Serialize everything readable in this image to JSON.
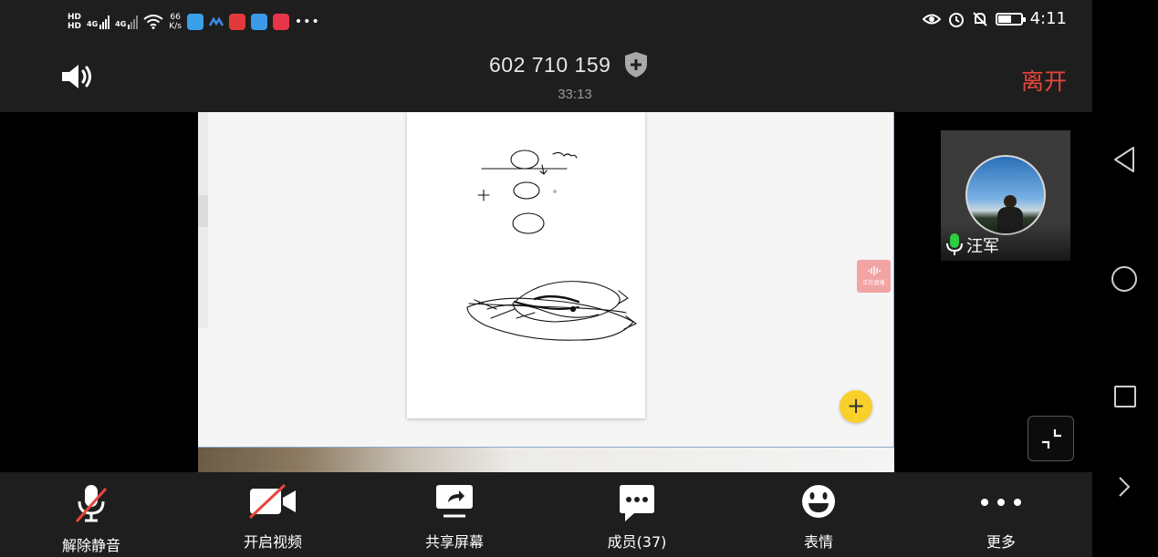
{
  "status_bar": {
    "network_top": "HD",
    "network_bottom": "HD",
    "sim1": "4G",
    "sim2": "4G",
    "speed_value": "66",
    "speed_unit": "K/s",
    "time": "4:11",
    "battery_level": 0.55
  },
  "header": {
    "meeting_id": "602 710 159",
    "elapsed": "33:13",
    "leave_label": "离开"
  },
  "shared_screen": {
    "live_badge_text": "正在直播",
    "fab_label": "+"
  },
  "participant": {
    "name": "汪军",
    "mic_color": "#2ecc40"
  },
  "toolbar": {
    "unmute_label": "解除静音",
    "video_label": "开启视频",
    "share_label": "共享屏幕",
    "members_label": "成员(37)",
    "reactions_label": "表情",
    "more_label": "更多"
  },
  "colors": {
    "bar_bg": "#1e1e1e",
    "leave": "#e8453c",
    "fab": "#f9cf2b",
    "mute_slash": "#e8453c"
  }
}
